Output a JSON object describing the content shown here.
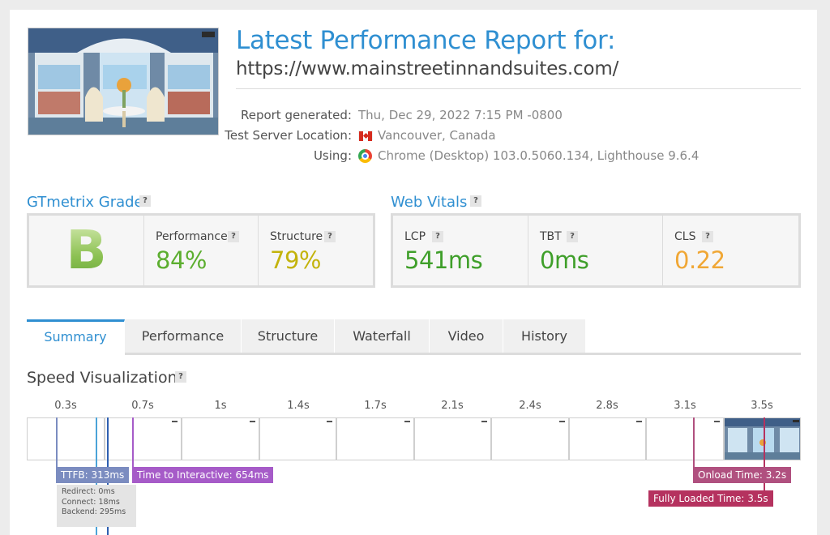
{
  "header": {
    "title": "Latest Performance Report for:",
    "url": "https://www.mainstreetinnandsuites.com/",
    "report_generated_label": "Report generated:",
    "report_generated_value": "Thu, Dec 29, 2022 7:15 PM -0800",
    "location_label": "Test Server Location:",
    "location_value": "Vancouver, Canada",
    "using_label": "Using:",
    "using_value": "Chrome (Desktop) 103.0.5060.134, Lighthouse 9.6.4"
  },
  "grade": {
    "heading": "GTmetrix Grade",
    "letter": "B",
    "performance_label": "Performance",
    "performance_value": "84%",
    "structure_label": "Structure",
    "structure_value": "79%"
  },
  "vitals": {
    "heading": "Web Vitals",
    "lcp_label": "LCP",
    "lcp_value": "541ms",
    "tbt_label": "TBT",
    "tbt_value": "0ms",
    "cls_label": "CLS",
    "cls_value": "0.22"
  },
  "help_badge": "?",
  "tabs": [
    "Summary",
    "Performance",
    "Structure",
    "Waterfall",
    "Video",
    "History"
  ],
  "speed": {
    "title": "Speed Visualization",
    "ticks": [
      "0.3s",
      "0.7s",
      "1s",
      "1.4s",
      "1.7s",
      "2.1s",
      "2.4s",
      "2.8s",
      "3.1s",
      "3.5s"
    ],
    "ttfb": "TTFB: 313ms",
    "ttfb_redirect": "Redirect: 0ms",
    "ttfb_connect": "Connect: 18ms",
    "ttfb_backend": "Backend: 295ms",
    "tti": "Time to Interactive: 654ms",
    "onload": "Onload Time: 3.2s",
    "fully_loaded": "Fully Loaded Time: 3.5s"
  },
  "colors": {
    "accent": "#2f8fd1",
    "good_green": "#5cae2f",
    "structure_yellow": "#c3b30b",
    "cls_orange": "#f0a735",
    "ttfb": "#7b8cc0",
    "tti": "#a65bc8",
    "onload": "#b0507f",
    "fully_loaded": "#b5325f"
  }
}
